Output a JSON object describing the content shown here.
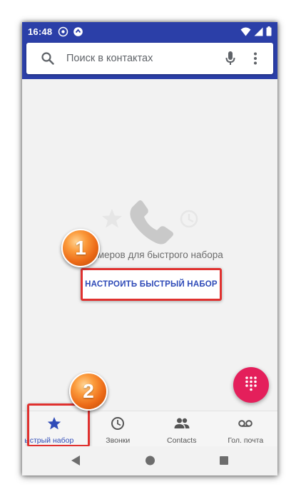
{
  "status_bar": {
    "time": "16:48",
    "icons_left": [
      "badge-icon",
      "sync-icon"
    ],
    "icons_right": [
      "wifi-icon",
      "signal-icon",
      "battery-icon"
    ]
  },
  "search": {
    "placeholder": "Поиск в контактах"
  },
  "empty_state": {
    "text": "омеров для быстрого набора",
    "action_label": "НАСТРОИТЬ БЫСТРЫЙ НАБОР"
  },
  "markers": {
    "one": "1",
    "two": "2"
  },
  "bottom_nav": {
    "items": [
      {
        "label": "ыстрый набор",
        "icon": "star-icon",
        "active": true
      },
      {
        "label": "Звонки",
        "icon": "clock-icon",
        "active": false
      },
      {
        "label": "Contacts",
        "icon": "people-icon",
        "active": false
      },
      {
        "label": "Гол. почта",
        "icon": "voicemail-icon",
        "active": false
      }
    ]
  },
  "colors": {
    "header": "#2b3fa8",
    "accent": "#2f4bb8",
    "fab": "#e41f5b",
    "highlight": "#e0312f",
    "marker": "#ec6a17"
  }
}
